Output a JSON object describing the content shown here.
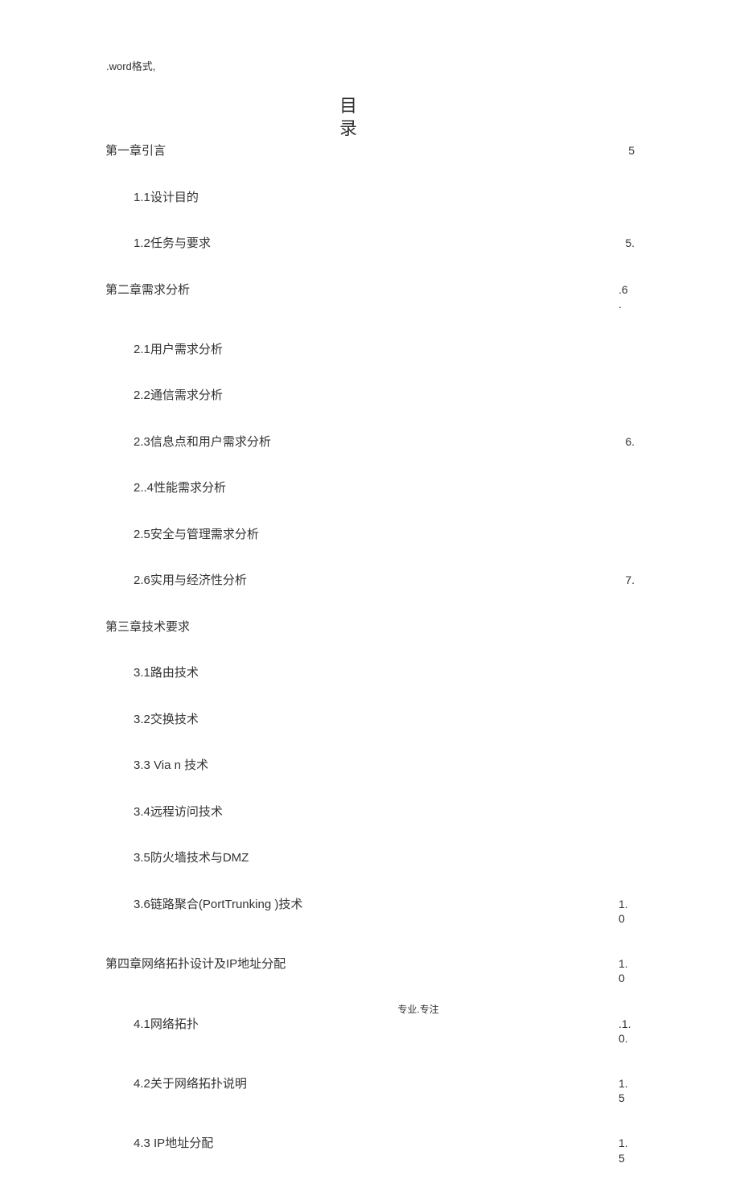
{
  "header_note": ".word格式,",
  "title": "目录",
  "toc": [
    {
      "level": 1,
      "label": "第一章引言",
      "page": "5"
    },
    {
      "level": 2,
      "label": "1.1设计目的",
      "page": ""
    },
    {
      "level": 2,
      "label": "1.2任务与要求",
      "page": "5."
    },
    {
      "level": 1,
      "label": "第二章需求分析",
      "page": ".6."
    },
    {
      "level": 2,
      "label": "2.1用户需求分析",
      "page": ""
    },
    {
      "level": 2,
      "label": "2.2通信需求分析",
      "page": ""
    },
    {
      "level": 2,
      "label": "2.3信息点和用户需求分析",
      "page": "6."
    },
    {
      "level": 2,
      "label": "2..4性能需求分析",
      "page": ""
    },
    {
      "level": 2,
      "label": "2.5安全与管理需求分析",
      "page": ""
    },
    {
      "level": 2,
      "label": "2.6实用与经济性分析",
      "page": "7."
    },
    {
      "level": 1,
      "label": "第三章技术要求",
      "page": ""
    },
    {
      "level": 2,
      "label": "3.1路由技术",
      "page": ""
    },
    {
      "level": 2,
      "label": "3.2交换技术",
      "page": ""
    },
    {
      "level": 2,
      "label": "3.3 Via n 技术",
      "page": ""
    },
    {
      "level": 2,
      "label": "3.4远程访问技术",
      "page": ""
    },
    {
      "level": 2,
      "label": "3.5防火墙技术与DMZ",
      "page": ""
    },
    {
      "level": 2,
      "label": "3.6链路聚合(PortTrunking )技术",
      "page": "1.0"
    },
    {
      "level": 1,
      "label": "第四章网络拓扑设计及IP地址分配",
      "page": "1.0"
    },
    {
      "level": 2,
      "label": "4.1网络拓扑",
      "page": ".1.0."
    },
    {
      "level": 2,
      "label": "4.2关于网络拓扑说明",
      "page": "1.5"
    },
    {
      "level": 2,
      "label": "4.3 IP地址分配",
      "page": "1.5"
    }
  ],
  "footer_note": "专业.专注"
}
